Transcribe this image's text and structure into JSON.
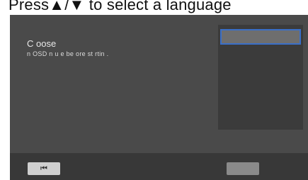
{
  "caption": "Press▲/▼ to select a language",
  "screen": {
    "title": "C oose",
    "subtitle": "n OSD   n  u    e be ore st  rtin  .",
    "language_list": {
      "items": [
        {
          "label": "",
          "selected": true
        }
      ]
    },
    "bottom_bar": {
      "prev_icon": "skip-previous-icon",
      "prev_glyph": "⏮"
    }
  },
  "colors": {
    "screen_bg": "#4a4a4a",
    "panel_bg": "#3b3b3b",
    "highlight_border": "#3a6fc8",
    "bottom_bar_bg": "#383838"
  }
}
